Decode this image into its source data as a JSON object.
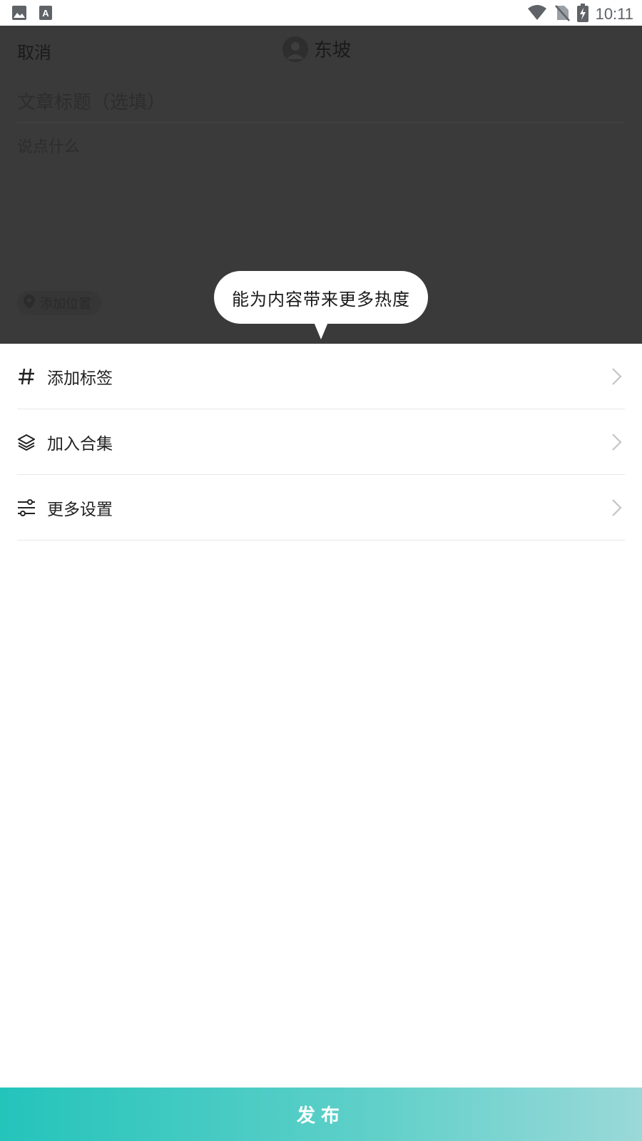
{
  "status_bar": {
    "time": "10:11",
    "left_icons": [
      "image-icon",
      "text-a-icon"
    ],
    "right_icons": [
      "wifi-icon",
      "no-sim-icon",
      "battery-charging-icon"
    ]
  },
  "composer": {
    "cancel_label": "取消",
    "author_name": "东坡",
    "title_placeholder": "文章标题（选填）",
    "body_placeholder": "说点什么",
    "location_label": "添加位置"
  },
  "tooltip": {
    "text": "能为内容带来更多热度"
  },
  "settings": {
    "items": [
      {
        "label": "添加标签",
        "icon": "hashtag-icon"
      },
      {
        "label": "加入合集",
        "icon": "layers-icon"
      },
      {
        "label": "更多设置",
        "icon": "sliders-icon"
      }
    ]
  },
  "publish": {
    "label": "发布"
  },
  "colors": {
    "accent_start": "#24c4bb",
    "accent_end": "#9ad9d9",
    "overlay": "#3a3a3a"
  }
}
